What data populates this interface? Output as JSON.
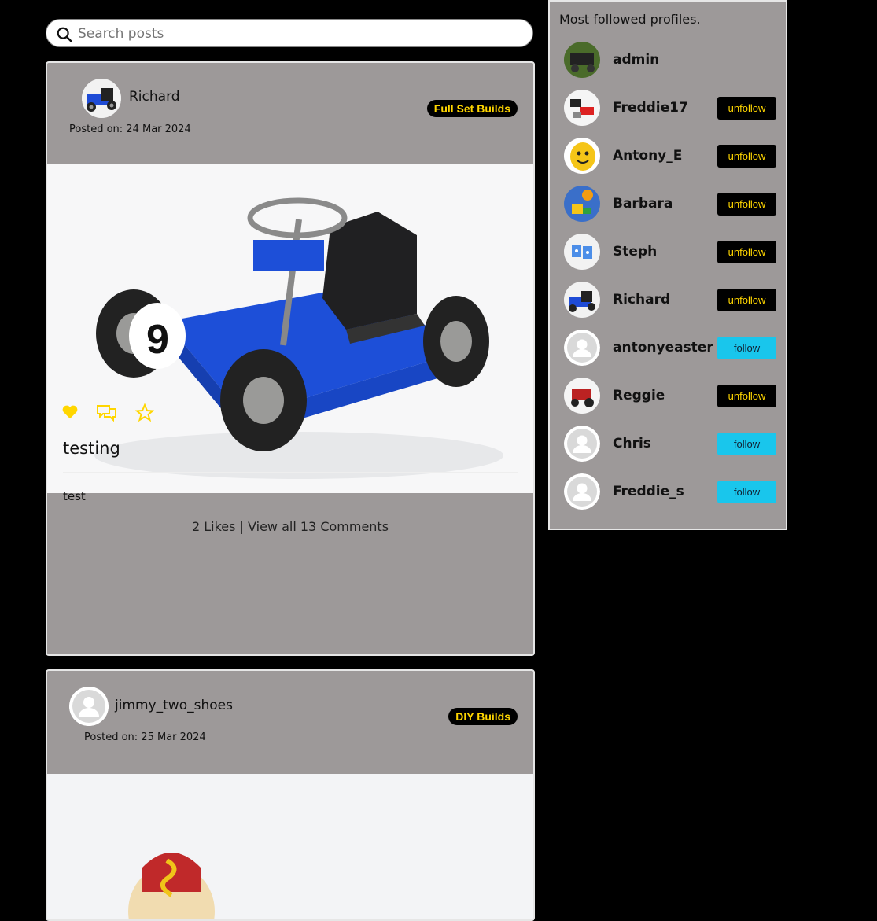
{
  "search": {
    "placeholder": "Search posts"
  },
  "posts": [
    {
      "author": "Richard",
      "posted_label": "Posted on:",
      "posted_date": "24 Mar 2024",
      "category": "Full Set Builds",
      "title": "testing",
      "body": "test",
      "likes": "2 Likes",
      "separator": "|",
      "comments": "View all 13 Comments"
    },
    {
      "author": "jimmy_two_shoes",
      "posted_label": "Posted on:",
      "posted_date": "25 Mar 2024",
      "category": "DIY Builds"
    }
  ],
  "sidebar": {
    "title": "Most followed profiles.",
    "profiles": [
      {
        "name": "admin",
        "button": ""
      },
      {
        "name": "Freddie17",
        "button": "unfollow"
      },
      {
        "name": "Antony_E",
        "button": "unfollow"
      },
      {
        "name": "Barbara",
        "button": "unfollow"
      },
      {
        "name": "Steph",
        "button": "unfollow"
      },
      {
        "name": "Richard",
        "button": "unfollow"
      },
      {
        "name": "antonyeaster",
        "button": "follow"
      },
      {
        "name": "Reggie",
        "button": "unfollow"
      },
      {
        "name": "Chris",
        "button": "follow"
      },
      {
        "name": "Freddie_s",
        "button": "follow"
      }
    ]
  },
  "colors": {
    "background": "#000000",
    "card": "#9d9999",
    "badge_text": "#ffd600",
    "action_icons": "#ffd600",
    "unfollow_button": "#000000",
    "follow_button": "#19c6ec"
  },
  "icons": {
    "search": "search-icon",
    "like": "heart-icon",
    "comment": "comments-icon",
    "save": "star-icon"
  }
}
